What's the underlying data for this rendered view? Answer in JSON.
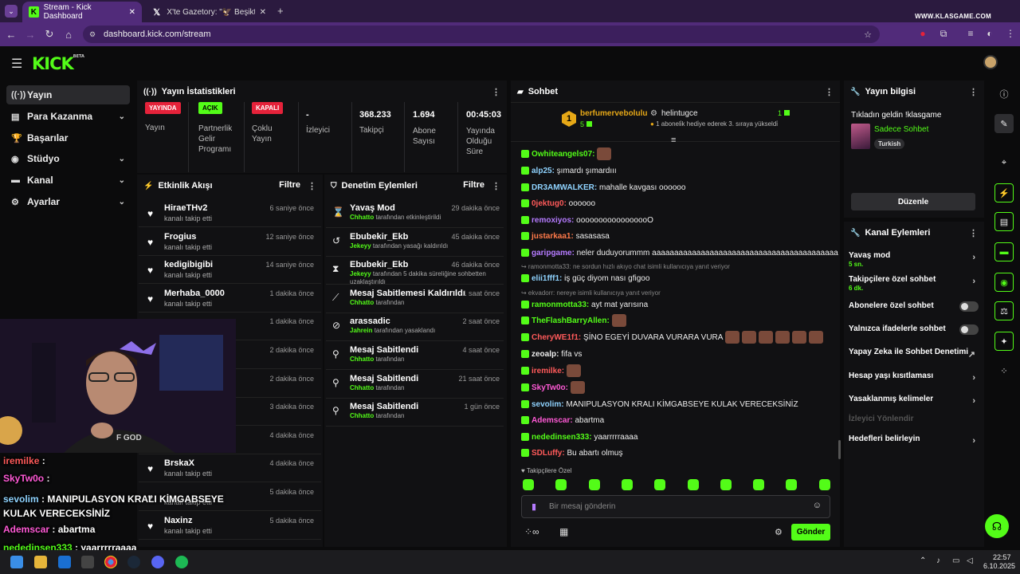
{
  "browser": {
    "tabs": [
      {
        "title": "Stream - Kick Dashboard",
        "active": true
      },
      {
        "title": "X'te Gazetory: \"🦅 Beşiktaşlı bi",
        "active": false
      }
    ],
    "url": "dashboard.kick.com/stream",
    "watermark": "WWW.KLASGAME.COM"
  },
  "header": {
    "logo": "KICK",
    "logo_badge": "BETA"
  },
  "sidebar": {
    "items": [
      {
        "label": "Yayın",
        "icon": "broadcast-icon",
        "active": true
      },
      {
        "label": "Para Kazanma",
        "icon": "money-icon",
        "expandable": true
      },
      {
        "label": "Başarılar",
        "icon": "trophy-icon"
      },
      {
        "label": "Stüdyo",
        "icon": "studio-icon",
        "expandable": true
      },
      {
        "label": "Kanal",
        "icon": "channel-icon",
        "expandable": true
      },
      {
        "label": "Ayarlar",
        "icon": "gear-icon",
        "expandable": true
      }
    ]
  },
  "stats": {
    "title": "Yayın İstatistikleri",
    "items": [
      {
        "value": "YAYINDA",
        "label": "Yayın",
        "color": "#e5223a"
      },
      {
        "value": "AÇIK",
        "label": "Partnerlik Gelir Programı",
        "color": "#53fc18"
      },
      {
        "value": "KAPALI",
        "label": "Çoklu Yayın",
        "color": "#e5223a"
      },
      {
        "value": "-",
        "label": "İzleyici"
      },
      {
        "value": "368.233",
        "label": "Takipçi"
      },
      {
        "value": "1.694",
        "label": "Abone Sayısı"
      },
      {
        "value": "00:45:03",
        "label": "Yayında Olduğu Süre"
      }
    ]
  },
  "activity": {
    "title": "Etkinlik Akışı",
    "filter": "Filtre",
    "items": [
      {
        "name": "HiraeTHv2",
        "action": "kanalı takip etti",
        "time": "6 saniye önce"
      },
      {
        "name": "Frogius",
        "action": "kanalı takip etti",
        "time": "12 saniye önce"
      },
      {
        "name": "kedigibigibi",
        "action": "kanalı takip etti",
        "time": "14 saniye önce"
      },
      {
        "name": "Merhaba_0000",
        "action": "kanalı takip etti",
        "time": "1 dakika önce"
      },
      {
        "name": "",
        "action": "",
        "time": "1 dakika önce"
      },
      {
        "name": "",
        "action": "",
        "time": "2 dakika önce"
      },
      {
        "name": "",
        "action": "",
        "time": "2 dakika önce"
      },
      {
        "name": "",
        "action": "",
        "time": "3 dakika önce"
      },
      {
        "name": "",
        "action": "",
        "time": "4 dakika önce"
      },
      {
        "name": "BrskaX",
        "action": "kanalı takip etti",
        "time": "4 dakika önce"
      },
      {
        "name": "",
        "action": "kanalı takip etti",
        "time": "5 dakika önce"
      },
      {
        "name": "Naxinz",
        "action": "kanalı takip etti",
        "time": "5 dakika önce"
      }
    ]
  },
  "moderation": {
    "title": "Denetim Eylemleri",
    "filter": "Filtre",
    "items": [
      {
        "title": "Yavaş Mod",
        "user": "Chhatto",
        "detail": "tarafından etkinleştirildi",
        "time": "29 dakika önce",
        "icon": "slow-mode-icon"
      },
      {
        "title": "Ebubekir_Ekb",
        "user": "Jekeyy",
        "detail": "tarafından yasağı kaldırıldı",
        "time": "45 dakika önce",
        "icon": "undo-icon"
      },
      {
        "title": "Ebubekir_Ekb",
        "user": "Jekeyy",
        "detail": "tarafından 5 dakika süreliğine sohbetten uzaklaştırıldı",
        "time": "46 dakika önce",
        "icon": "hourglass-icon"
      },
      {
        "title": "Mesaj Sabitlemesi Kaldırıldı",
        "user": "Chhatto",
        "detail": "tarafından",
        "time": "1 saat önce",
        "icon": "unpin-icon"
      },
      {
        "title": "arassadic",
        "user": "Jahrein",
        "detail": "tarafından yasaklandı",
        "time": "2 saat önce",
        "icon": "ban-icon"
      },
      {
        "title": "Mesaj Sabitlendi",
        "user": "Chhatto",
        "detail": "tarafından",
        "time": "4 saat önce",
        "icon": "pin-icon"
      },
      {
        "title": "Mesaj Sabitlendi",
        "user": "Chhatto",
        "detail": "tarafından",
        "time": "21 saat önce",
        "icon": "pin-icon"
      },
      {
        "title": "Mesaj Sabitlendi",
        "user": "Chhatto",
        "detail": "tarafından",
        "time": "1 gün önce",
        "icon": "pin-icon"
      }
    ]
  },
  "chat": {
    "title": "Sohbet",
    "top_gifter": {
      "rank": "1",
      "name": "berfumervebolulu",
      "count": "5"
    },
    "gift_event": {
      "name": "helintugce",
      "count": "1",
      "text": "1 aboneli̇k hedi̇ye ederek 3. sıraya yükseldi̇"
    },
    "messages": [
      {
        "user": "Owhiteangels07",
        "text": "",
        "color": "#53fc18",
        "emotes": 1
      },
      {
        "user": "alp25",
        "text": "şımardı şımardııı",
        "color": "#8fd3ff"
      },
      {
        "user": "DR3AMWALKER",
        "text": "mahalle kavgası oooooo",
        "color": "#8fd3ff"
      },
      {
        "user": "0jektug0",
        "text": "oooooo",
        "color": "#ff5a5a"
      },
      {
        "user": "remoxiyos",
        "text": "ooooooooooooooooO",
        "color": "#b57bff"
      },
      {
        "user": "justarkaa1",
        "text": "sasasasa",
        "color": "#ff7a4a"
      },
      {
        "user": "garipgame",
        "text": "neler duduyorummm aaaaaaaaaaaaaaaaaaaaaaaaaaaaaaaaaaaaaaaaaaa",
        "color": "#b57bff"
      },
      {
        "reply": "ramonmotta33: ne sordun hızlı akıyo chat isimli kullanıcıya yanıt veriyor",
        "user": "elii1fff1",
        "text": "iş güç diyom nası gfigoo",
        "color": "#8fd3ff"
      },
      {
        "reply": "ekvadorr: nereye isimli kullanıcıya yanıt veriyor",
        "user": "ramonmotta33",
        "text": "ayt mat yarısına",
        "color": "#53fc18"
      },
      {
        "user": "TheFlashBarryAllen",
        "text": "",
        "color": "#53fc18",
        "emotes": 1
      },
      {
        "user": "CheryWE1f1",
        "text": "ŞİNO EGEYİ DUVARA VURARA VURA",
        "color": "#ff5a5a",
        "emotes": 6
      },
      {
        "user": "zeoalp",
        "text": "fifa vs",
        "color": "#eeeeee"
      },
      {
        "user": "iremilke",
        "text": "",
        "color": "#ff5a5a",
        "emotes": 1
      },
      {
        "user": "SkyTw0o",
        "text": "",
        "color": "#ff5ad6",
        "emotes": 1
      },
      {
        "user": "sevolim",
        "text": "MANIPULASYON KRALI KİMGABSEYE KULAK VERECEKSİNİZ",
        "color": "#8fd3ff"
      },
      {
        "user": "Ademscar",
        "text": "abartma",
        "color": "#ff5ad6"
      },
      {
        "user": "nededinsen333",
        "text": "yaarrrrraaaa",
        "color": "#53fc18"
      },
      {
        "user": "SDLuffy",
        "text": "Bu abartı olmuş",
        "color": "#ff5a5a"
      }
    ],
    "followers_only": "Takipçilere Özel",
    "input_placeholder": "Bir mesaj gönderin",
    "send_label": "Gönder"
  },
  "stream_info": {
    "title": "Yayın bilgisi",
    "stream_title": "Tıkladın geldin !klasgame",
    "category": "Sadece Sohbet",
    "tag": "Turkish",
    "edit_label": "Düzenle"
  },
  "channel_actions": {
    "title": "Kanal Eylemleri",
    "items": [
      {
        "label": "Yavaş mod",
        "sub": "5 sn.",
        "control": "chevron"
      },
      {
        "label": "Takipçilere özel sohbet",
        "sub": "6 dk.",
        "control": "chevron"
      },
      {
        "label": "Abonelere özel sohbet",
        "control": "toggle"
      },
      {
        "label": "Yalnızca ifadelerle sohbet",
        "control": "toggle"
      },
      {
        "label": "Yapay Zeka ile Sohbet Denetimi",
        "control": "external"
      },
      {
        "label": "Hesap yaşı kısıtlaması",
        "control": "chevron"
      },
      {
        "label": "Yasaklanmış kelimeler",
        "control": "chevron"
      },
      {
        "label": "İzleyici Yönlendir",
        "control": "disabled"
      },
      {
        "label": "Hedefleri belirleyin",
        "control": "chevron"
      }
    ]
  },
  "overlay_chat": [
    {
      "user": "iremilke",
      "text": ":",
      "color": "#ff5a5a"
    },
    {
      "user": "SkyTw0o",
      "text": ":",
      "color": "#ff5ad6"
    },
    {
      "user": "sevolim",
      "text": ": MANIPULASYON KRALI KİMGABSEYE KULAK VERECEKSİNİZ",
      "color": "#8fd3ff"
    },
    {
      "user": "Ademscar",
      "text": ": abartma",
      "color": "#ff5ad6"
    },
    {
      "user": "nededinsen333",
      "text": ": yaarrrrraaaa",
      "color": "#53fc18"
    }
  ],
  "webcam_text": "F GOD",
  "taskbar": {
    "time": "22:57",
    "date": "6.10.2025"
  }
}
